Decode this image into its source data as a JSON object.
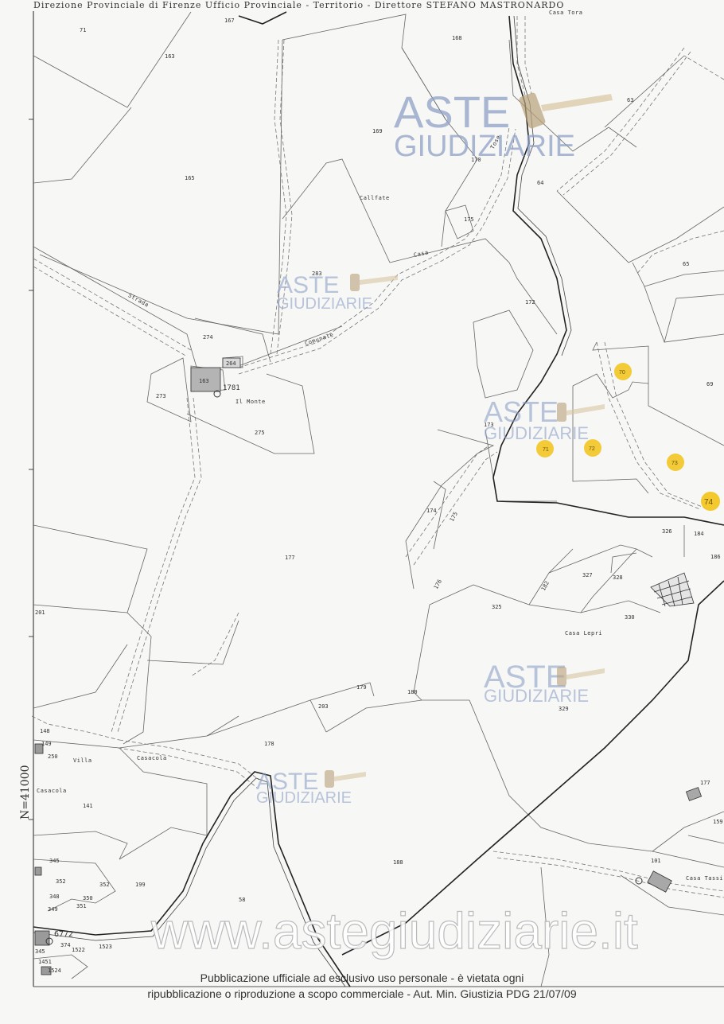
{
  "header": "Direzione Provinciale di Firenze Ufficio Provinciale - Territorio - Direttore STEFANO MASTRONARDO",
  "coordinate_label": "N=41000",
  "place_labels": [
    "Casa Tora",
    "Callfate",
    "Strada",
    "Casa",
    "Il Monte",
    "Casa Lepri",
    "Casacola",
    "Casacola",
    "Villa",
    "Casa Tassi"
  ],
  "road_labels": [
    "Strada",
    "Comunale",
    "Tose"
  ],
  "parcels": [
    "71",
    "167",
    "168",
    "163",
    "169",
    "170",
    "165",
    "64",
    "175",
    "Casa",
    "63",
    "283",
    "274",
    "172",
    "264",
    "163",
    "1781",
    "273",
    "65",
    "275",
    "70",
    "69",
    "173",
    "71",
    "72",
    "73",
    "74",
    "174",
    "175",
    "326",
    "184",
    "177",
    "327",
    "328",
    "186",
    "176",
    "325",
    "330",
    "201",
    "182",
    "179",
    "180",
    "329",
    "203",
    "178",
    "148",
    "149",
    "250",
    "141",
    "177",
    "345",
    "188",
    "101",
    "352",
    "352",
    "199",
    "348",
    "350",
    "58",
    "349",
    "351",
    "6772",
    "374",
    "1522",
    "1523",
    "345",
    "1451",
    "1524",
    "159"
  ],
  "highlighted_parcels": [
    "70",
    "71",
    "72",
    "73",
    "74"
  ],
  "watermarks": {
    "brand_top": "ASTE",
    "brand_bottom": "GIUDIZIARIE",
    "url": "www.astegiudiziarie.it"
  },
  "disclaimer_line1": "Pubblicazione ufficiale ad esclusivo uso personale - è vietata ogni",
  "disclaimer_line2": "ripubblicazione o riproduzione a scopo commerciale - Aut. Min. Giustizia PDG 21/07/09",
  "colors": {
    "marker": "#f2c318",
    "watermark": "#8ea1c6",
    "line": "#555555"
  }
}
